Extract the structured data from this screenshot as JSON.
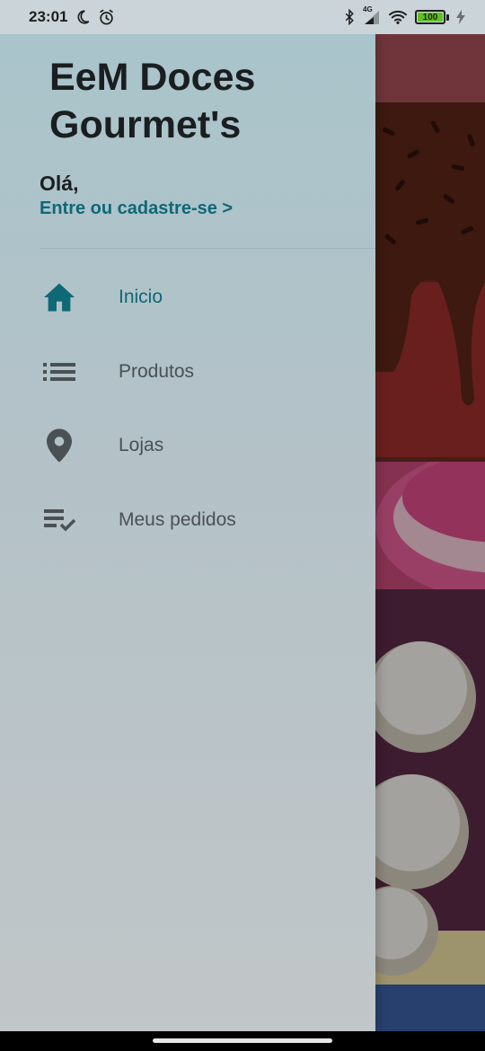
{
  "status_bar": {
    "time": "23:01",
    "battery_level": "100",
    "network_type": "4G",
    "icons": [
      "moon-icon",
      "alarm-icon",
      "bluetooth-icon",
      "cellular-signal-icon",
      "wifi-icon",
      "battery-icon",
      "charging-icon"
    ]
  },
  "drawer": {
    "app_title": "EeM Doces Gourmet's",
    "greeting": "Olá,",
    "login_link": "Entre ou cadastre-se >",
    "menu": [
      {
        "label": "Inicio",
        "icon": "home-icon",
        "active": true
      },
      {
        "label": "Produtos",
        "icon": "list-icon",
        "active": false
      },
      {
        "label": "Lojas",
        "icon": "location-pin-icon",
        "active": false
      },
      {
        "label": "Meus pedidos",
        "icon": "playlist-check-icon",
        "active": false
      }
    ]
  },
  "colors": {
    "accent": "#0f6876",
    "drawer_top": "#a9c4cb",
    "drawer_bottom": "#c1c6c8",
    "app_bar": "#a54e57",
    "text_primary": "#1b1e20",
    "text_secondary": "#4a5053",
    "icon_inactive": "#4a5053"
  }
}
